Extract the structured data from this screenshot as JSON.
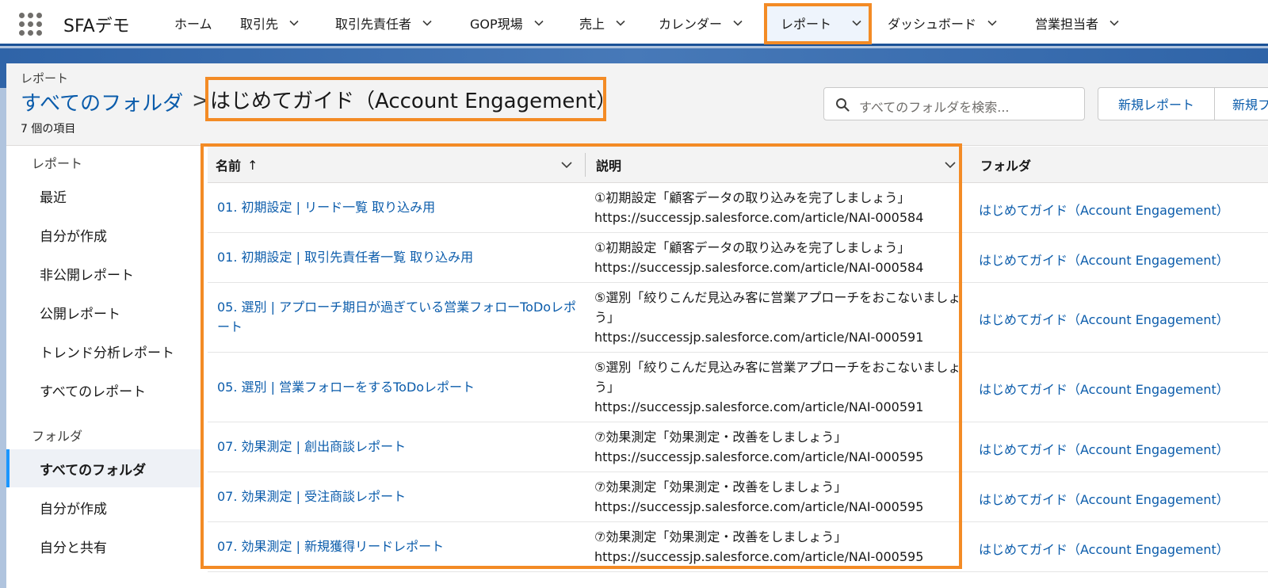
{
  "app": {
    "name": "SFAデモ"
  },
  "nav": {
    "items": [
      {
        "label": "ホーム",
        "has_menu": false
      },
      {
        "label": "取引先",
        "has_menu": true
      },
      {
        "label": "取引先責任者",
        "has_menu": true
      },
      {
        "label": "GOP現場",
        "has_menu": true
      },
      {
        "label": "売上",
        "has_menu": true
      },
      {
        "label": "カレンダー",
        "has_menu": true
      },
      {
        "label": "レポート",
        "has_menu": true,
        "selected": true
      },
      {
        "label": "ダッシュボード",
        "has_menu": true
      },
      {
        "label": "営業担当者",
        "has_menu": true
      }
    ]
  },
  "header": {
    "section": "レポート",
    "breadcrumb_link": "すべてのフォルダ",
    "separator": ">",
    "title": "はじめてガイド（Account Engagement）",
    "count": "7 個の項目",
    "search_placeholder": "すべてのフォルダを検索...",
    "new_report_label": "新規レポート",
    "new_folder_label": "新規フ"
  },
  "sidebar": {
    "reports_heading": "レポート",
    "report_items": [
      "最近",
      "自分が作成",
      "非公開レポート",
      "公開レポート",
      "トレンド分析レポート",
      "すべてのレポート"
    ],
    "folders_heading": "フォルダ",
    "folder_items": [
      "すべてのフォルダ",
      "自分が作成",
      "自分と共有"
    ],
    "active_item": "すべてのフォルダ"
  },
  "table": {
    "columns": {
      "name": "名前",
      "name_sort": "↑",
      "description": "説明",
      "folder": "フォルダ"
    },
    "rows": [
      {
        "name": "01. 初期設定 | リード一覧 取り込み用",
        "desc1": "①初期設定「顧客データの取り込みを完了しましょう」",
        "desc2": "https://successjp.salesforce.com/article/NAI-000584",
        "folder": "はじめてガイド（Account Engagement）"
      },
      {
        "name": "01. 初期設定 | 取引先責任者一覧 取り込み用",
        "desc1": "①初期設定「顧客データの取り込みを完了しましょう」",
        "desc2": "https://successjp.salesforce.com/article/NAI-000584",
        "folder": "はじめてガイド（Account Engagement）"
      },
      {
        "name": "05. 選別 | アプローチ期日が過ぎている営業フォローToDoレポート",
        "desc1": "⑤選別「絞りこんだ見込み客に営業アプローチをおこないましょう」",
        "desc2": "https://successjp.salesforce.com/article/NAI-000591",
        "folder": "はじめてガイド（Account Engagement）"
      },
      {
        "name": "05. 選別 | 営業フォローをするToDoレポート",
        "desc1": "⑤選別「絞りこんだ見込み客に営業アプローチをおこないましょう」",
        "desc2": "https://successjp.salesforce.com/article/NAI-000591",
        "folder": "はじめてガイド（Account Engagement）"
      },
      {
        "name": "07. 効果測定 | 創出商談レポート",
        "desc1": "⑦効果測定「効果測定・改善をしましょう」",
        "desc2": "https://successjp.salesforce.com/article/NAI-000595",
        "folder": "はじめてガイド（Account Engagement）"
      },
      {
        "name": "07. 効果測定 | 受注商談レポート",
        "desc1": "⑦効果測定「効果測定・改善をしましょう」",
        "desc2": "https://successjp.salesforce.com/article/NAI-000595",
        "folder": "はじめてガイド（Account Engagement）"
      },
      {
        "name": "07. 効果測定 | 新規獲得リードレポート",
        "desc1": "⑦効果測定「効果測定・改善をしましょう」",
        "desc2": "https://successjp.salesforce.com/article/NAI-000595",
        "folder": "はじめてガイド（Account Engagement）"
      }
    ]
  },
  "colors": {
    "link": "#0b5cab",
    "highlight": "#f38b25",
    "nav_underline": "#1b5297"
  }
}
